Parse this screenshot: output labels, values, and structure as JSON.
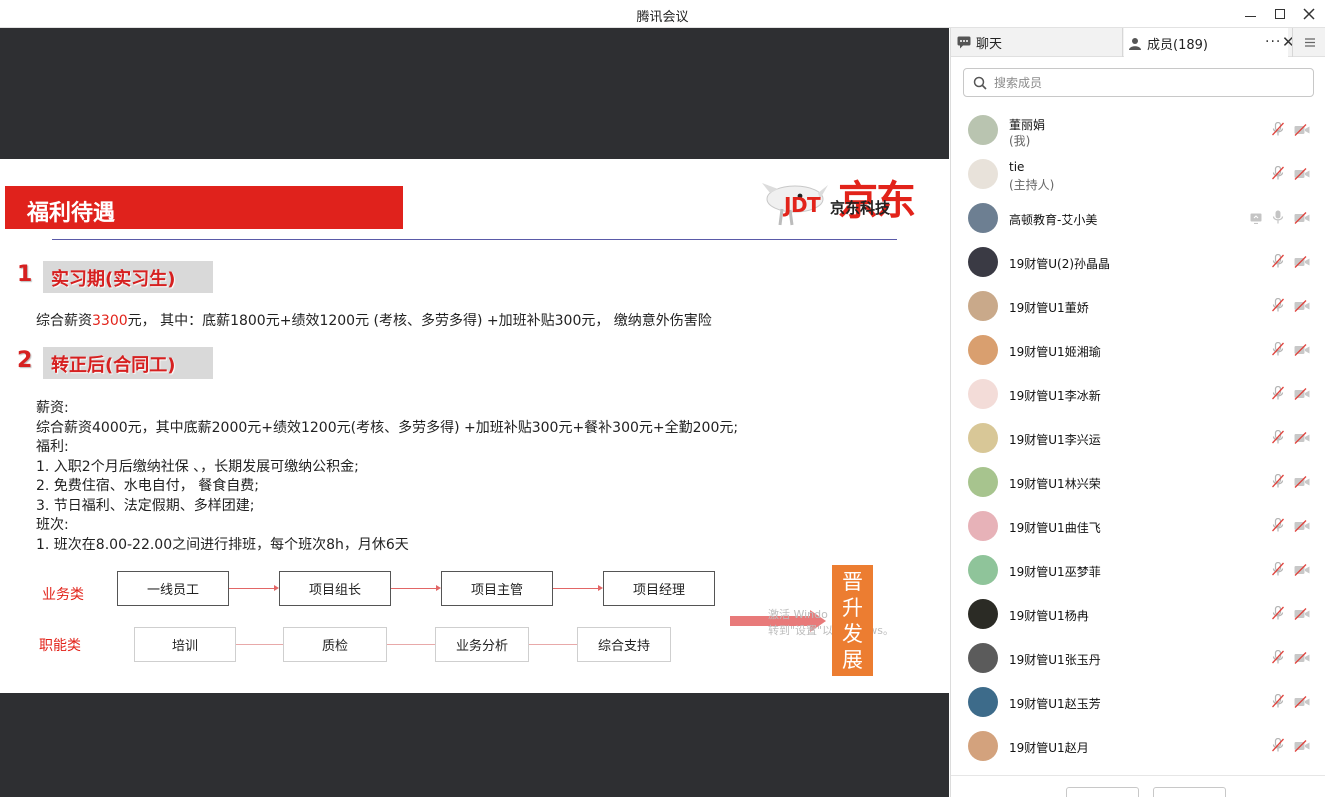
{
  "window": {
    "title": "腾讯会议"
  },
  "slide": {
    "banner": "福利待遇",
    "logo": {
      "jdt": "JDT",
      "jdkj": "京东科技",
      "jd": "京东"
    },
    "section1": {
      "num": "1",
      "title": "实习期(实习生)"
    },
    "section1_text": {
      "pre": "综合薪资",
      "highlight": "3300",
      "post": "元，  其中：底薪1800元+绩效1200元 (考核、多劳多得) +加班补贴300元，  缴纳意外伤害险"
    },
    "section2": {
      "num": "2",
      "title": "转正后(合同工)"
    },
    "body_lines": [
      "薪资:",
      "综合薪资4000元，其中底薪2000元+绩效1200元(考核、多劳多得) +加班补贴300元+餐补300元+全勤200元;",
      "福利:",
      "1.    入职2个月后缴纳社保 、，长期发展可缴纳公积金;",
      "2.    免费住宿、水电自付，  餐食自费;",
      "3.    节日福利、法定假期、多样团建;",
      "班次:",
      "1.    班次在8.00-22.00之间进行排班，每个班次8h，月休6天"
    ],
    "chart": {
      "row1_label": "业务类",
      "row2_label": "职能类",
      "row1": [
        "一线员工",
        "项目组长",
        "项目主管",
        "项目经理"
      ],
      "row2": [
        "培训",
        "质检",
        "业务分析",
        "综合支持"
      ],
      "promote": "晋升发展"
    },
    "watermark": [
      "激活 Windo",
      "转到\"设置\"以激 ndows。"
    ]
  },
  "panel": {
    "tab_chat": "聊天",
    "tab_members": "成员(189)",
    "search_placeholder": "搜索成员",
    "members": [
      {
        "name": "董丽娟",
        "sub": "(我)",
        "avatar_color": "#b9c4b0",
        "icons": "standard"
      },
      {
        "name": "tie",
        "sub": "(主持人)",
        "avatar_color": "#e8e2da",
        "icons": "standard"
      },
      {
        "name": "高顿教育-艾小美",
        "sub": "",
        "avatar_color": "#6d7f92",
        "icons": "share"
      },
      {
        "name": "19财管U(2)孙晶晶",
        "sub": "",
        "avatar_color": "#3a3a44",
        "icons": "standard"
      },
      {
        "name": "19财管U1董娇",
        "sub": "",
        "avatar_color": "#c9a98a",
        "icons": "standard"
      },
      {
        "name": "19财管U1姬湘瑜",
        "sub": "",
        "avatar_color": "#d99f6f",
        "icons": "standard"
      },
      {
        "name": "19财管U1李冰新",
        "sub": "",
        "avatar_color": "#f3dcd8",
        "icons": "standard"
      },
      {
        "name": "19财管U1李兴运",
        "sub": "",
        "avatar_color": "#d8c797",
        "icons": "standard"
      },
      {
        "name": "19财管U1林兴荣",
        "sub": "",
        "avatar_color": "#a7c48e",
        "icons": "standard"
      },
      {
        "name": "19财管U1曲佳飞",
        "sub": "",
        "avatar_color": "#e7b2b8",
        "icons": "standard"
      },
      {
        "name": "19财管U1巫梦菲",
        "sub": "",
        "avatar_color": "#8fc49a",
        "icons": "standard"
      },
      {
        "name": "19财管U1杨冉",
        "sub": "",
        "avatar_color": "#2b2b25",
        "icons": "standard"
      },
      {
        "name": "19财管U1张玉丹",
        "sub": "",
        "avatar_color": "#5b5b5b",
        "icons": "standard"
      },
      {
        "name": "19财管U1赵玉芳",
        "sub": "",
        "avatar_color": "#3d6b8a",
        "icons": "standard"
      },
      {
        "name": "19财管U1赵月",
        "sub": "",
        "avatar_color": "#d3a27d",
        "icons": "standard"
      }
    ]
  },
  "colors": {
    "accent_red": "#e2231a",
    "stage_bg": "#2e2f32",
    "promote_orange": "#ec7d31"
  }
}
